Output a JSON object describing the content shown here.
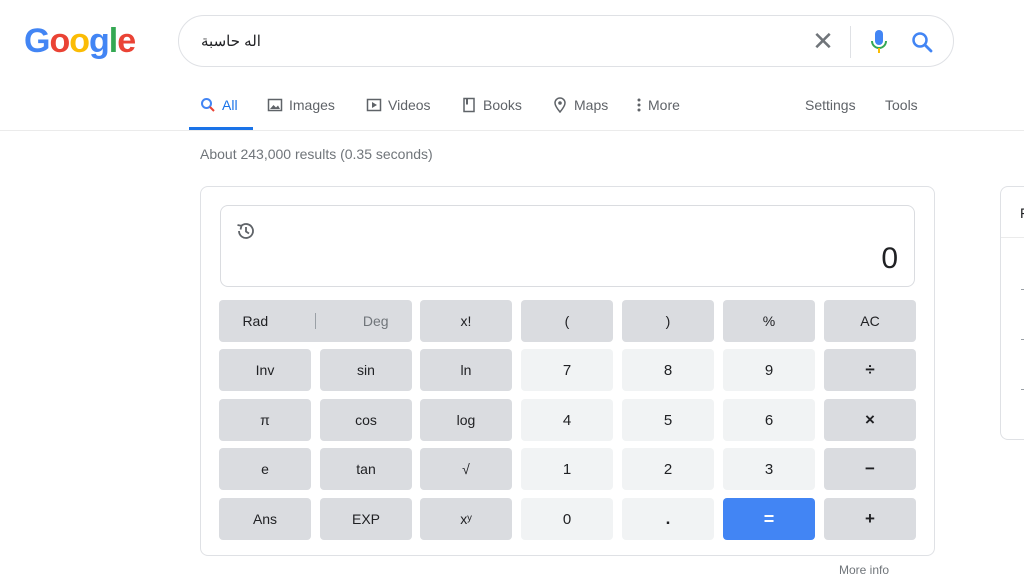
{
  "logo": {
    "text": "Google",
    "letters": [
      "G",
      "o",
      "o",
      "g",
      "l",
      "e"
    ],
    "colors": [
      "#4285f4",
      "#ea4335",
      "#fbbc05",
      "#4285f4",
      "#34a853",
      "#ea4335"
    ]
  },
  "search": {
    "query": "اله حاسبة",
    "clear_icon": "close-icon",
    "mic_icon": "mic-icon",
    "search_icon": "search-icon"
  },
  "tabs": [
    {
      "label": "All",
      "icon": "search-icon",
      "active": true
    },
    {
      "label": "Images",
      "icon": "image-icon"
    },
    {
      "label": "Videos",
      "icon": "video-icon"
    },
    {
      "label": "Books",
      "icon": "book-icon"
    },
    {
      "label": "Maps",
      "icon": "map-pin-icon"
    },
    {
      "label": "More",
      "icon": "more-vert-icon"
    }
  ],
  "tools": {
    "settings": "Settings",
    "tools": "Tools"
  },
  "result_stats": "About 243,000 results (0.35 seconds)",
  "calculator": {
    "display": "0",
    "history_icon": "history-icon",
    "rad": "Rad",
    "deg": "Deg",
    "keys": {
      "fact": "x!",
      "lparen": "(",
      "rparen": ")",
      "percent": "%",
      "ac": "AC",
      "inv": "Inv",
      "sin": "sin",
      "ln": "ln",
      "k7": "7",
      "k8": "8",
      "k9": "9",
      "div": "÷",
      "pi": "π",
      "cos": "cos",
      "log": "log",
      "k4": "4",
      "k5": "5",
      "k6": "6",
      "mul": "×",
      "e": "e",
      "tan": "tan",
      "sqrt": "√",
      "k1": "1",
      "k2": "2",
      "k3": "3",
      "minus": "−",
      "ans": "Ans",
      "exp": "EXP",
      "pow": "xʸ",
      "k0": "0",
      "dot": ".",
      "eq": "=",
      "plus": "+"
    },
    "more_info": "More info"
  },
  "side_panel": {
    "letter": "F"
  },
  "accent_color": "#1a73e8",
  "equals_color": "#4285f4"
}
